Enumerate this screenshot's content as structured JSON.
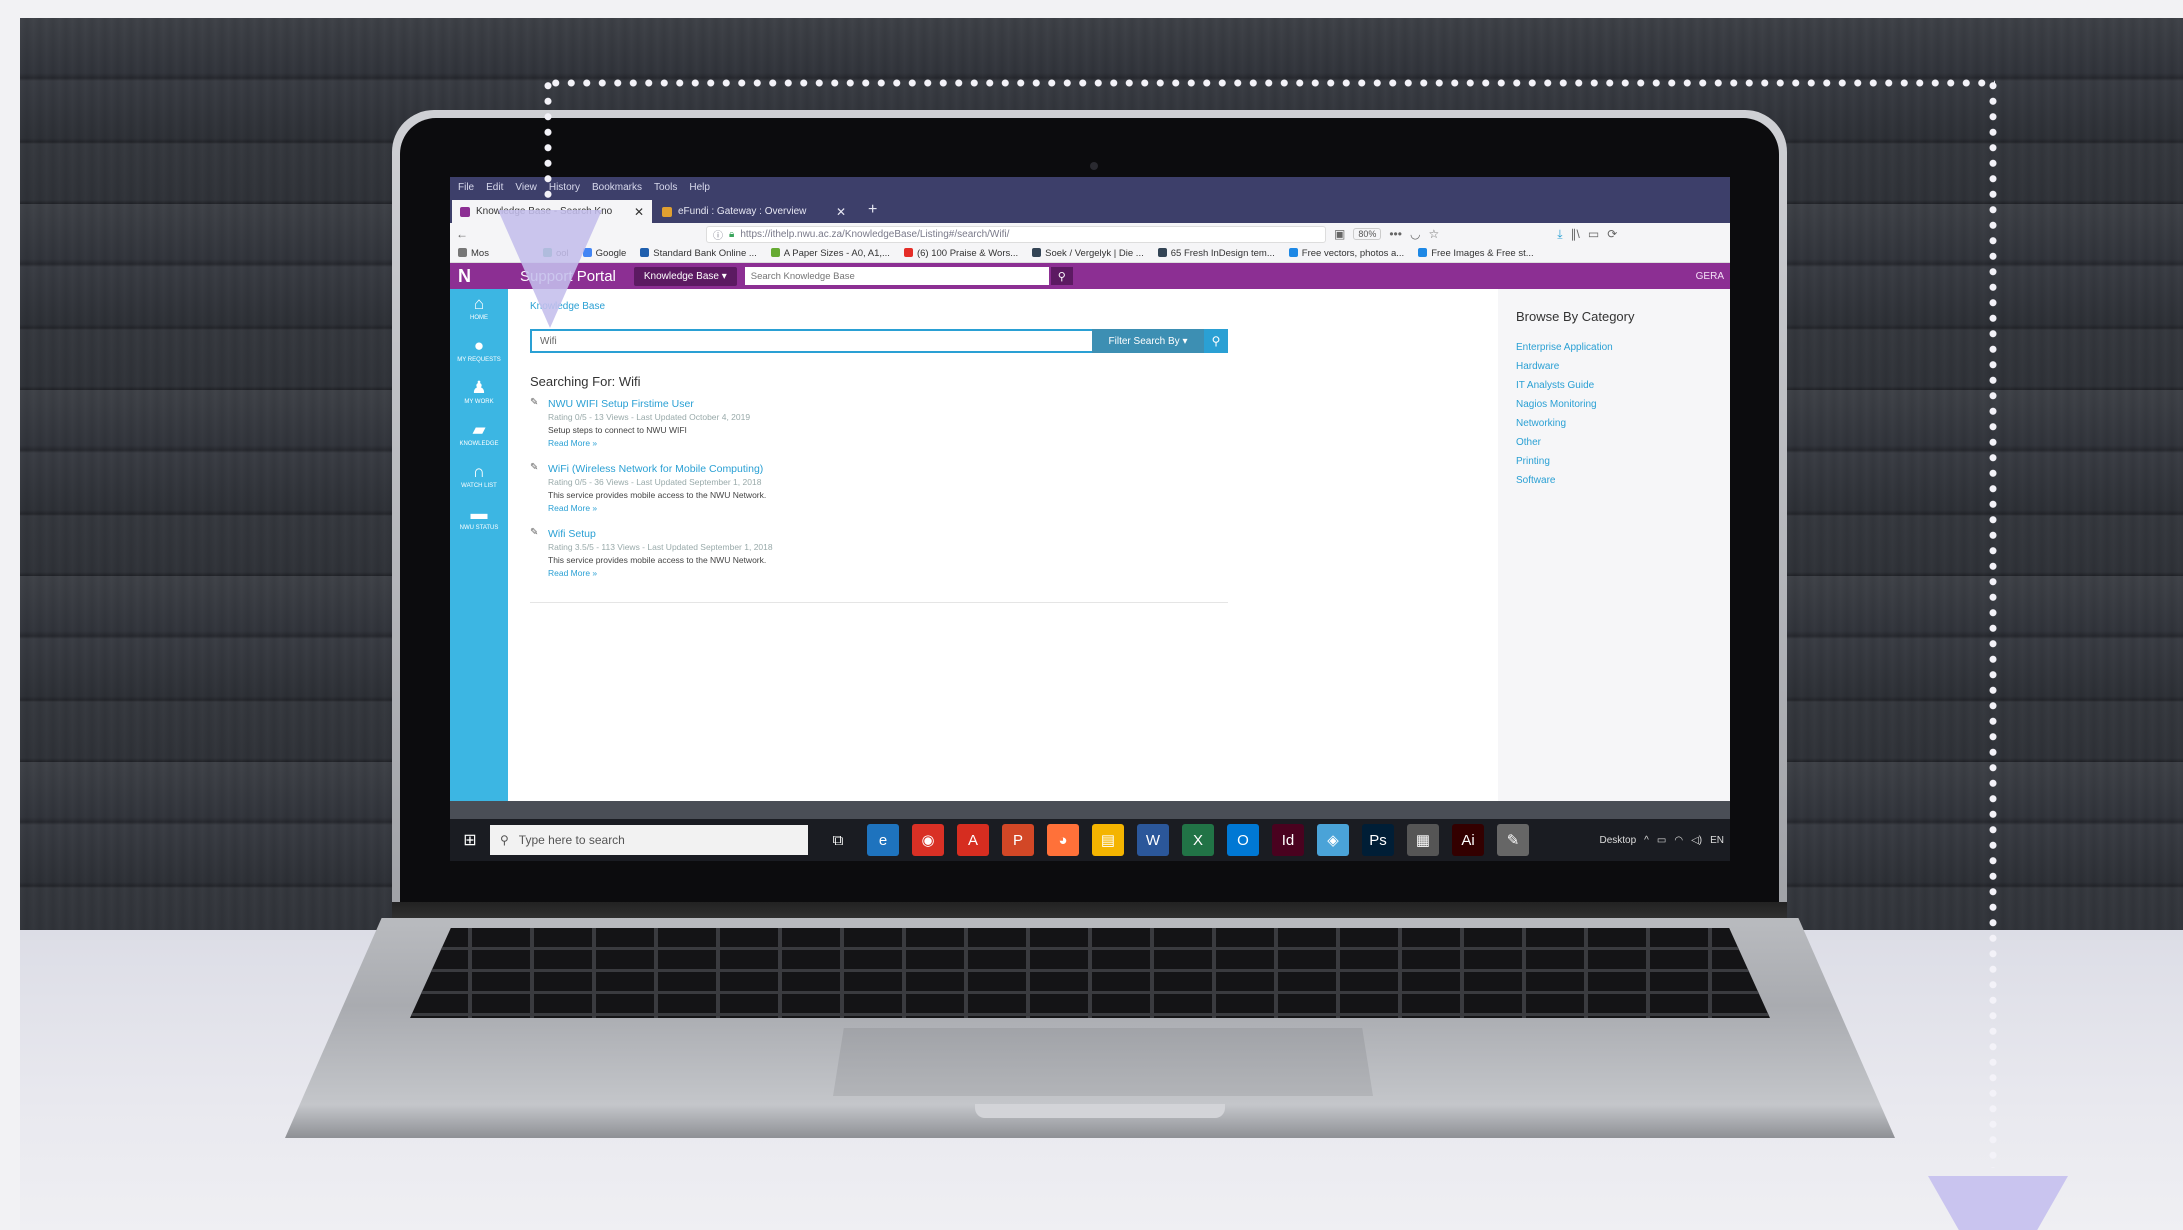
{
  "browser": {
    "menu": [
      "File",
      "Edit",
      "View",
      "History",
      "Bookmarks",
      "Tools",
      "Help"
    ],
    "tabs": [
      {
        "title": "Knowledge Base - Search Kno",
        "active": true,
        "favicon_color": "#8c2f93"
      },
      {
        "title": "eFundi : Gateway : Overview",
        "active": false,
        "favicon_color": "#e0a030"
      }
    ],
    "close_symbol": "✕",
    "new_tab_symbol": "+",
    "url": "https://ithelp.nwu.ac.za/KnowledgeBase/Listing#/search/Wifi/",
    "zoom": "80%",
    "more_symbol": "•••",
    "bookmarks": [
      {
        "label": "Mos",
        "icon_color": "#777"
      },
      {
        "label": "ool",
        "icon_color": "#2a7"
      },
      {
        "label": "Google",
        "icon_color": "#4285f4"
      },
      {
        "label": "Standard Bank Online ...",
        "icon_color": "#1f5fae"
      },
      {
        "label": "A Paper Sizes - A0, A1,...",
        "icon_color": "#6a3"
      },
      {
        "label": "(6) 100 Praise & Wors...",
        "icon_color": "#e52d27"
      },
      {
        "label": "Soek / Vergelyk | Die ...",
        "icon_color": "#345"
      },
      {
        "label": "65 Fresh InDesign tem...",
        "icon_color": "#345"
      },
      {
        "label": "Free vectors, photos a...",
        "icon_color": "#1e88e5"
      },
      {
        "label": "Free Images & Free st...",
        "icon_color": "#1e88e5"
      }
    ]
  },
  "portal": {
    "logo_letter": "N",
    "title": "Support Portal",
    "kb_dropdown": "Knowledge Base ▾",
    "search_placeholder": "Search Knowledge Base",
    "user_abbr": "GERA",
    "colors": {
      "header": "#8c2f93",
      "sidebar": "#3cb6e3",
      "link": "#2aa0d4"
    }
  },
  "sidebar": {
    "items": [
      {
        "label": "HOME",
        "icon": "home-icon",
        "glyph": "⌂"
      },
      {
        "label": "MY REQUESTS",
        "icon": "chat-icon",
        "glyph": "●"
      },
      {
        "label": "MY WORK",
        "icon": "user-icon",
        "glyph": "♟"
      },
      {
        "label": "KNOWLEDGE",
        "icon": "book-icon",
        "glyph": "▰"
      },
      {
        "label": "WATCH LIST",
        "icon": "binoculars-icon",
        "glyph": "∩"
      },
      {
        "label": "NWU STATUS",
        "icon": "truck-icon",
        "glyph": "▬"
      }
    ]
  },
  "main": {
    "breadcrumb": "Knowledge Base",
    "search_value": "Wifi",
    "filter_label": "Filter Search By ▾",
    "searching_for": "Searching For: Wifi",
    "read_more": "Read More »",
    "results": [
      {
        "title": "NWU WIFI Setup Firstime User",
        "meta": "Rating 0/5 - 13 Views - Last Updated October 4, 2019",
        "desc": "Setup steps to connect to NWU WIFI"
      },
      {
        "title": "WiFi (Wireless Network for Mobile Computing)",
        "meta": "Rating 0/5 - 36 Views - Last Updated September 1, 2018",
        "desc": "This service provides mobile access to the NWU Network."
      },
      {
        "title": "Wifi Setup",
        "meta": "Rating 3.5/5 - 113 Views - Last Updated September 1, 2018",
        "desc": "This service provides mobile access to the NWU Network."
      }
    ]
  },
  "categories": {
    "title": "Browse By Category",
    "items": [
      "Enterprise Application",
      "Hardware",
      "IT Analysts Guide",
      "Nagios Monitoring",
      "Networking",
      "Other",
      "Printing",
      "Software"
    ]
  },
  "taskbar": {
    "search_placeholder": "Type here to search",
    "desktop_label": "Desktop",
    "lang": "EN",
    "apps": [
      {
        "name": "task-view-icon",
        "glyph": "⧉",
        "color": "transparent"
      },
      {
        "name": "edge-icon",
        "glyph": "e",
        "color": "#1e73be"
      },
      {
        "name": "chrome-icon",
        "glyph": "◉",
        "color": "#d93025"
      },
      {
        "name": "acrobat-icon",
        "glyph": "A",
        "color": "#d62d20"
      },
      {
        "name": "powerpoint-icon",
        "glyph": "P",
        "color": "#d24726"
      },
      {
        "name": "firefox-icon",
        "glyph": "◕",
        "color": "#ff7139"
      },
      {
        "name": "explorer-icon",
        "glyph": "▤",
        "color": "#f4b400"
      },
      {
        "name": "word-icon",
        "glyph": "W",
        "color": "#2b579a"
      },
      {
        "name": "excel-icon",
        "glyph": "X",
        "color": "#217346"
      },
      {
        "name": "outlook-icon",
        "glyph": "O",
        "color": "#0078d4"
      },
      {
        "name": "indesign-icon",
        "glyph": "Id",
        "color": "#49021f"
      },
      {
        "name": "network-icon",
        "glyph": "◈",
        "color": "#4aa3d8"
      },
      {
        "name": "photoshop-icon",
        "glyph": "Ps",
        "color": "#001e36"
      },
      {
        "name": "media-icon",
        "glyph": "▦",
        "color": "#555"
      },
      {
        "name": "illustrator-icon",
        "glyph": "Ai",
        "color": "#330000"
      },
      {
        "name": "paint-icon",
        "glyph": "✎",
        "color": "#666"
      }
    ]
  }
}
